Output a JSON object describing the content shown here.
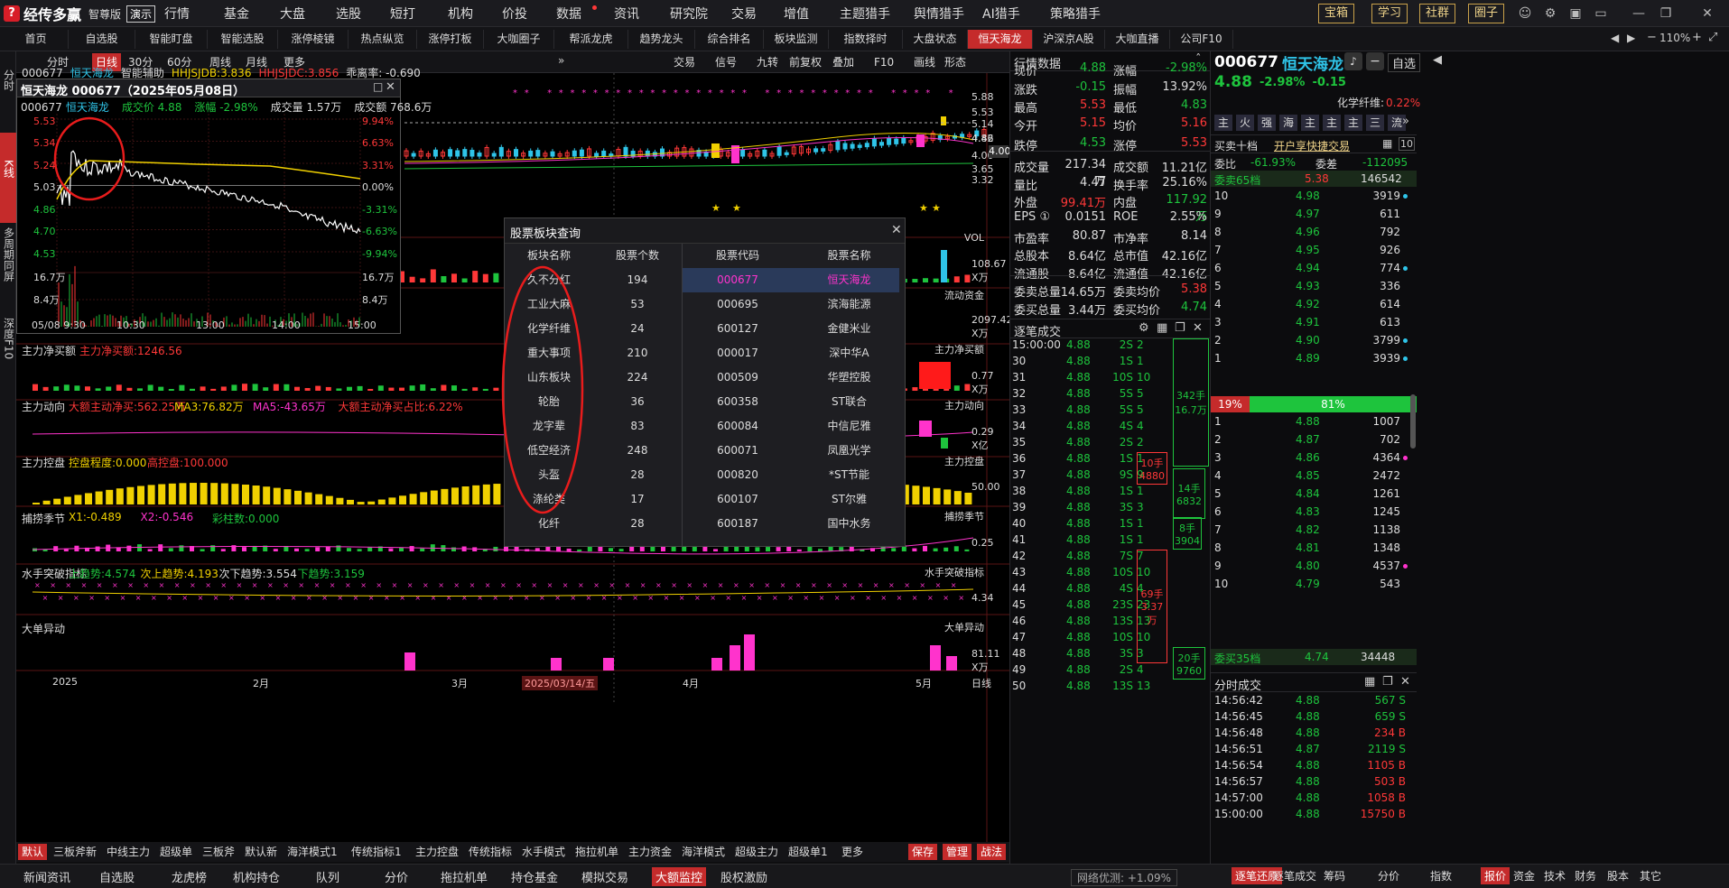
{
  "app": {
    "logo_text": "经传多赢",
    "edition": "智尊版",
    "demo_label": "演示"
  },
  "top_menu": [
    "行情",
    "基金",
    "大盘",
    "选股",
    "短打",
    "机构",
    "价投",
    "数据",
    "资讯",
    "研究院",
    "交易",
    "增值",
    "主题猎手",
    "舆情猎手",
    "AI猎手",
    "策略猎手"
  ],
  "top_buttons": [
    "宝箱",
    "学习",
    "社群",
    "圈子"
  ],
  "tabs": [
    "首页",
    "自选股",
    "智能盯盘",
    "智能选股",
    "涨停棱镜",
    "热点纵览",
    "涨停打板",
    "大咖圈子",
    "帮派龙虎",
    "趋势龙头",
    "综合排名",
    "板块监测",
    "指数择时",
    "大盘状态",
    "恒天海龙",
    "沪深京A股",
    "大咖直播",
    "公司F10"
  ],
  "tabs_active": "恒天海龙",
  "tab_nav": {
    "zoom": "110%"
  },
  "left_col": [
    {
      "label": "分时",
      "active": false
    },
    {
      "label": "K线",
      "active": true
    },
    {
      "label": "多周期同屏",
      "active": false
    },
    {
      "label": "深度F10",
      "active": false
    }
  ],
  "chart_toolbar": [
    "分时",
    "日线",
    "30分",
    "60分",
    "周线",
    "月线",
    "更多"
  ],
  "chart_toolbar_active": "日线",
  "chart_toolbar_right": [
    "交易",
    "信号",
    "九转",
    "前复权",
    "叠加",
    "F10",
    "画线",
    "形态"
  ],
  "kline_header": {
    "code": "000677",
    "name": "恒天海龙",
    "assist": "智能辅助",
    "hhjsjdb": "HHJSJDB:3.836",
    "hhjsjdc": "HHJSJDC:3.856",
    "ratio": "乖离率: -0.690"
  },
  "price_axis": [
    "5.88",
    "5.53",
    "5.14",
    "4.86",
    "4.42",
    "4.00",
    "3.65",
    "3.32"
  ],
  "vol_axis": [
    "108.67",
    "X万"
  ],
  "panels": [
    {
      "name": "VOL",
      "right": "VOL",
      "axis1": "108.67",
      "axis2": "X万"
    },
    {
      "name": "流动资金",
      "right": "流动资金",
      "axis1": "2097.42",
      "axis2": "X万"
    },
    {
      "name": "主力净买额",
      "label": "主力净买额:1246.56",
      "right": "主力净买额",
      "axis1": "0.77",
      "axis2": "X万"
    },
    {
      "name": "主力动向",
      "labels": [
        "大额主动净买:562.25万",
        "MA3:76.82万",
        "MA5:-43.65万",
        "大额主动净买占比:6.22%"
      ],
      "right": "主力动向",
      "axis1": "0.29",
      "axis2": "X亿"
    },
    {
      "name": "主力控盘",
      "labels": [
        "控盘程度:0.000",
        "高控盘:100.000"
      ],
      "right": "主力控盘",
      "axis1": "50.00"
    },
    {
      "name": "捕捞季节",
      "labels": [
        "X1:-0.489",
        "X2:-0.546",
        "彩柱数:0.000"
      ],
      "right": "捕捞季节",
      "axis1": "0.25"
    },
    {
      "name": "水手突破指标",
      "labels": [
        "上趋势:4.574",
        "次上趋势:4.193",
        "次下趋势:3.554",
        "下趋势:3.159"
      ],
      "right": "水手突破指标",
      "axis1": "4.34"
    },
    {
      "name": "大单异动",
      "right": "大单异动",
      "axis1": "81.11",
      "axis2": "X万"
    }
  ],
  "x_axis": [
    "2025",
    "2月",
    "3月",
    "2025/03/14/五",
    "4月",
    "5月",
    "日线"
  ],
  "bottom_toolbar": [
    "默认",
    "三板斧新",
    "中线主力",
    "超级单",
    "三板斧",
    "默认新",
    "海洋模式1",
    "传统指标1",
    "主力控盘",
    "传统指标",
    "水手模式",
    "拖拉机单",
    "主力资金",
    "海洋模式",
    "超级主力",
    "超级单1",
    "更多"
  ],
  "bottom_toolbar_right": [
    "保存",
    "管理",
    "战法"
  ],
  "bottom_strip": [
    "新闻资讯",
    "自选股",
    "龙虎榜",
    "机构持仓",
    "队列",
    "分价",
    "拖拉机单",
    "持仓基金",
    "模拟交易",
    "大额监控",
    "股权激励"
  ],
  "bottom_strip_active": "大额监控",
  "net_status": "网络优测: +1.09%",
  "bottom_strip_right": [
    "逐笔还原",
    "逐笔成交",
    "筹码",
    "分价",
    "指数",
    "报价",
    "资金",
    "技术",
    "财务",
    "股本",
    "其它"
  ],
  "intraday": {
    "title": "恒天海龙 000677（2025年05月08日）",
    "code": "000677",
    "name": "恒天海龙",
    "deal": "成交价 4.88",
    "chg": "涨幅 -2.98%",
    "vol": "成交量 1.57万",
    "amt": "成交额 768.6万",
    "left_axis": [
      "5.53",
      "5.34",
      "5.24",
      "5.03",
      "4.86",
      "4.70",
      "4.53",
      "16.7万",
      "8.4万"
    ],
    "right_axis": [
      "9.94%",
      "6.63%",
      "3.31%",
      "0.00%",
      "-3.31%",
      "-6.63%",
      "-9.94%",
      "16.7万",
      "8.4万"
    ],
    "time_axis": [
      "05/08 9:30",
      "10:30",
      "13:00",
      "14:00",
      "15:00"
    ]
  },
  "modal": {
    "title": "股票板块查询",
    "headers": [
      "板块名称",
      "股票个数",
      "股票代码",
      "股票名称"
    ],
    "sectors": [
      [
        "久不分红",
        "194"
      ],
      [
        "工业大麻",
        "53"
      ],
      [
        "化学纤维",
        "24"
      ],
      [
        "重大事项",
        "210"
      ],
      [
        "山东板块",
        "224"
      ],
      [
        "轮胎",
        "36"
      ],
      [
        "龙字辈",
        "83"
      ],
      [
        "低空经济",
        "248"
      ],
      [
        "头盔",
        "28"
      ],
      [
        "涤纶类",
        "17"
      ],
      [
        "化纤",
        "28"
      ]
    ],
    "stocks": [
      [
        "000677",
        "恒天海龙"
      ],
      [
        "000695",
        "滨海能源"
      ],
      [
        "600127",
        "金健米业"
      ],
      [
        "000017",
        "深中华A"
      ],
      [
        "000509",
        "华塑控股"
      ],
      [
        "600358",
        "ST联合"
      ],
      [
        "600084",
        "中信尼雅"
      ],
      [
        "600071",
        "凤凰光学"
      ],
      [
        "000820",
        "*ST节能"
      ],
      [
        "600107",
        "ST尔雅"
      ],
      [
        "600187",
        "国中水务"
      ]
    ]
  },
  "quote": {
    "header": "行情数据",
    "rows": [
      [
        "现价",
        "4.88",
        "涨幅",
        "-2.98%"
      ],
      [
        "涨跌",
        "-0.15",
        "振幅",
        "13.92%"
      ],
      [
        "最高",
        "5.53",
        "最低",
        "4.83"
      ],
      [
        "今开",
        "5.15",
        "均价",
        "5.16"
      ],
      [
        "跌停",
        "4.53",
        "涨停",
        "5.53"
      ],
      [
        "成交量",
        "217.34万",
        "成交额",
        "11.21亿"
      ],
      [
        "量比",
        "4.47",
        "换手率",
        "25.16%"
      ],
      [
        "外盘",
        "99.41万",
        "内盘",
        "117.92万"
      ],
      [
        "EPS ①",
        "0.0151",
        "ROE",
        "2.55%"
      ],
      [
        "市盈率",
        "80.87",
        "市净率",
        "8.14"
      ],
      [
        "总股本",
        "8.64亿",
        "总市值",
        "42.16亿"
      ],
      [
        "流通股",
        "8.64亿",
        "流通值",
        "42.16亿"
      ],
      [
        "委卖总量",
        "14.65万",
        "委卖均价",
        "5.38"
      ],
      [
        "委买总量",
        "3.44万",
        "委买均价",
        "4.74"
      ]
    ],
    "tick_header": "逐笔成交",
    "ticks": [
      [
        "15:00:00",
        "4.88",
        "2S",
        "2"
      ],
      [
        "30",
        "4.88",
        "1S",
        "1"
      ],
      [
        "31",
        "4.88",
        "10S",
        "10"
      ],
      [
        "32",
        "4.88",
        "5S",
        "5"
      ],
      [
        "33",
        "4.88",
        "5S",
        "5"
      ],
      [
        "34",
        "4.88",
        "4S",
        "4"
      ],
      [
        "35",
        "4.88",
        "2S",
        "2"
      ],
      [
        "36",
        "4.88",
        "1S",
        "1"
      ],
      [
        "37",
        "4.88",
        "9S",
        "9"
      ],
      [
        "38",
        "4.88",
        "1S",
        "1"
      ],
      [
        "39",
        "4.88",
        "3S",
        "3"
      ],
      [
        "40",
        "4.88",
        "1S",
        "1"
      ],
      [
        "41",
        "4.88",
        "1S",
        "1"
      ],
      [
        "42",
        "4.88",
        "7S",
        "7"
      ],
      [
        "43",
        "4.88",
        "10S",
        "10"
      ],
      [
        "44",
        "4.88",
        "4S",
        "4"
      ],
      [
        "45",
        "4.88",
        "23S",
        "23"
      ],
      [
        "46",
        "4.88",
        "13S",
        "13"
      ],
      [
        "47",
        "4.88",
        "10S",
        "10"
      ],
      [
        "48",
        "4.88",
        "3S",
        "3"
      ],
      [
        "49",
        "4.88",
        "2S",
        "4"
      ],
      [
        "50",
        "4.88",
        "13S",
        "13"
      ]
    ],
    "tick_boxes": [
      "342手",
      "16.7万",
      "10手",
      "4880",
      "14手",
      "6832",
      "8手",
      "3904",
      "69手",
      "3.37万",
      "20手",
      "9760"
    ]
  },
  "orderbook": {
    "code": "000677",
    "name": "恒天海龙",
    "price": "4.88",
    "chg": "-2.98%",
    "chg_abs": "-0.15",
    "add_watch": "自选",
    "sector": "化学纤维:",
    "sector_pct": "0.22%",
    "ind_buttons": [
      "主",
      "火",
      "强",
      "海",
      "主",
      "主",
      "主",
      "三",
      "流"
    ],
    "level10_label": "买卖十档",
    "open_fast": "开户享快捷交易",
    "wb_label": "委比",
    "wb": "-61.93%",
    "wc_label": "委差",
    "wc": "-112095",
    "sell_head": "委卖65档",
    "sell_head_p": "5.38",
    "sell_head_v": "146542",
    "asks": [
      [
        "10",
        "4.98",
        "3919"
      ],
      [
        "9",
        "4.97",
        "611"
      ],
      [
        "8",
        "4.96",
        "792"
      ],
      [
        "7",
        "4.95",
        "926"
      ],
      [
        "6",
        "4.94",
        "774"
      ],
      [
        "5",
        "4.93",
        "336"
      ],
      [
        "4",
        "4.92",
        "614"
      ],
      [
        "3",
        "4.91",
        "613"
      ],
      [
        "2",
        "4.90",
        "3799"
      ],
      [
        "1",
        "4.89",
        "3939"
      ]
    ],
    "ratio_left": "19%",
    "ratio_right": "81%",
    "bids": [
      [
        "1",
        "4.88",
        "1007"
      ],
      [
        "2",
        "4.87",
        "702"
      ],
      [
        "3",
        "4.86",
        "4364"
      ],
      [
        "4",
        "4.85",
        "2472"
      ],
      [
        "5",
        "4.84",
        "1261"
      ],
      [
        "6",
        "4.83",
        "1245"
      ],
      [
        "7",
        "4.82",
        "1138"
      ],
      [
        "8",
        "4.81",
        "1348"
      ],
      [
        "9",
        "4.80",
        "4537"
      ],
      [
        "10",
        "4.79",
        "543"
      ]
    ],
    "buy_head": "委买35档",
    "buy_head_p": "4.74",
    "buy_head_v": "34448",
    "tick_title": "分时成交",
    "ticks": [
      [
        "14:56:42",
        "4.88",
        "567 S"
      ],
      [
        "14:56:45",
        "4.88",
        "659 S"
      ],
      [
        "14:56:48",
        "4.88",
        "234 B"
      ],
      [
        "14:56:51",
        "4.87",
        "2119 S"
      ],
      [
        "14:56:54",
        "4.88",
        "1105 B"
      ],
      [
        "14:56:57",
        "4.88",
        "503 B"
      ],
      [
        "14:57:00",
        "4.88",
        "1058 B"
      ],
      [
        "15:00:00",
        "4.88",
        "15750 B"
      ]
    ]
  },
  "colors": {
    "up": "#ff3838",
    "down": "#1ec43d",
    "accent": "#c52b2b",
    "cyan": "#2fc4e8",
    "magenta": "#ff33cc",
    "yellow": "#f0d000"
  }
}
